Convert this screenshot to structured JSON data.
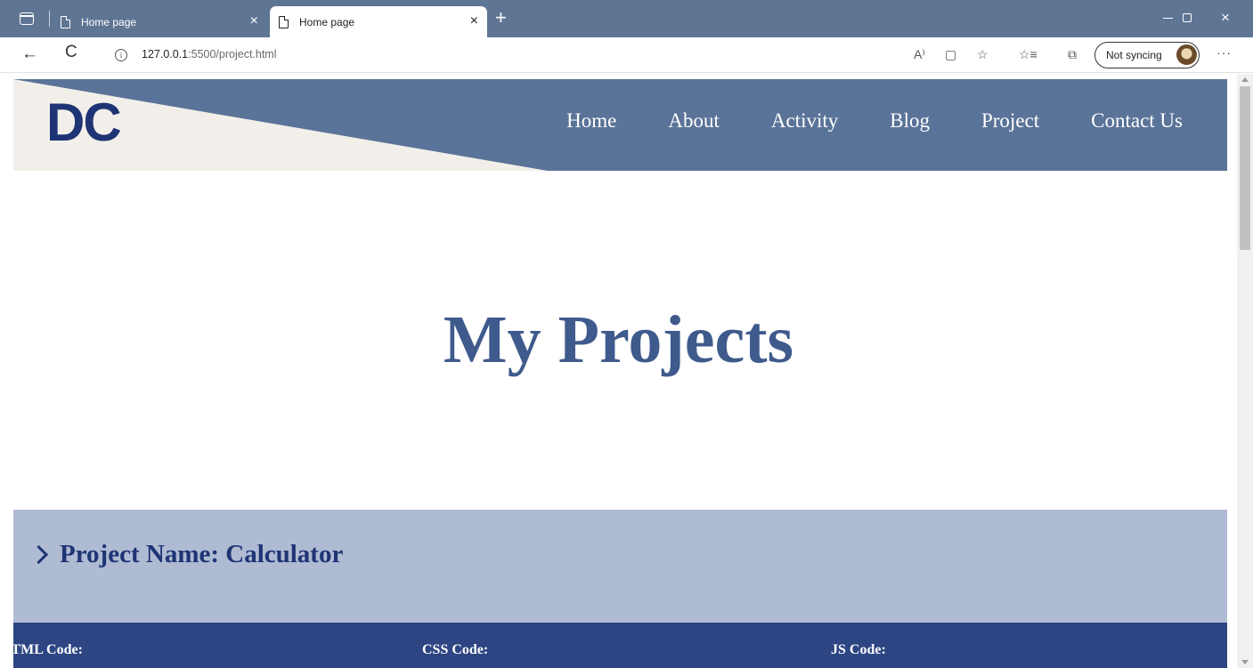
{
  "browser": {
    "tabs": [
      {
        "title": "Home page",
        "active": false
      },
      {
        "title": "Home page",
        "active": true
      }
    ],
    "url": {
      "host": "127.0.0.1",
      "rest": ":5500/project.html"
    },
    "sync_label": "Not syncing",
    "icons": {
      "back": "←",
      "reload": "C",
      "info": "i",
      "read_aloud": "A⁾",
      "immersive_reader": "▢",
      "favorite_add": "☆",
      "favorites": "☆≡",
      "collections": "⧉",
      "more": "···",
      "new_tab": "+",
      "close": "×"
    }
  },
  "site": {
    "logo": "DC",
    "nav": [
      "Home",
      "About",
      "Activity",
      "Blog",
      "Project",
      "Contact Us"
    ],
    "colors": {
      "header": "#5a7398",
      "logo": "#1e3474",
      "title": "#3f5a8c",
      "band_light": "#afbad3",
      "band_dark": "#2d4583"
    }
  },
  "main": {
    "title": "My Projects",
    "project": {
      "name": "Project Name: Calculator",
      "code_labels": [
        "HTML Code:",
        "CSS Code:",
        "JS Code:"
      ]
    }
  }
}
